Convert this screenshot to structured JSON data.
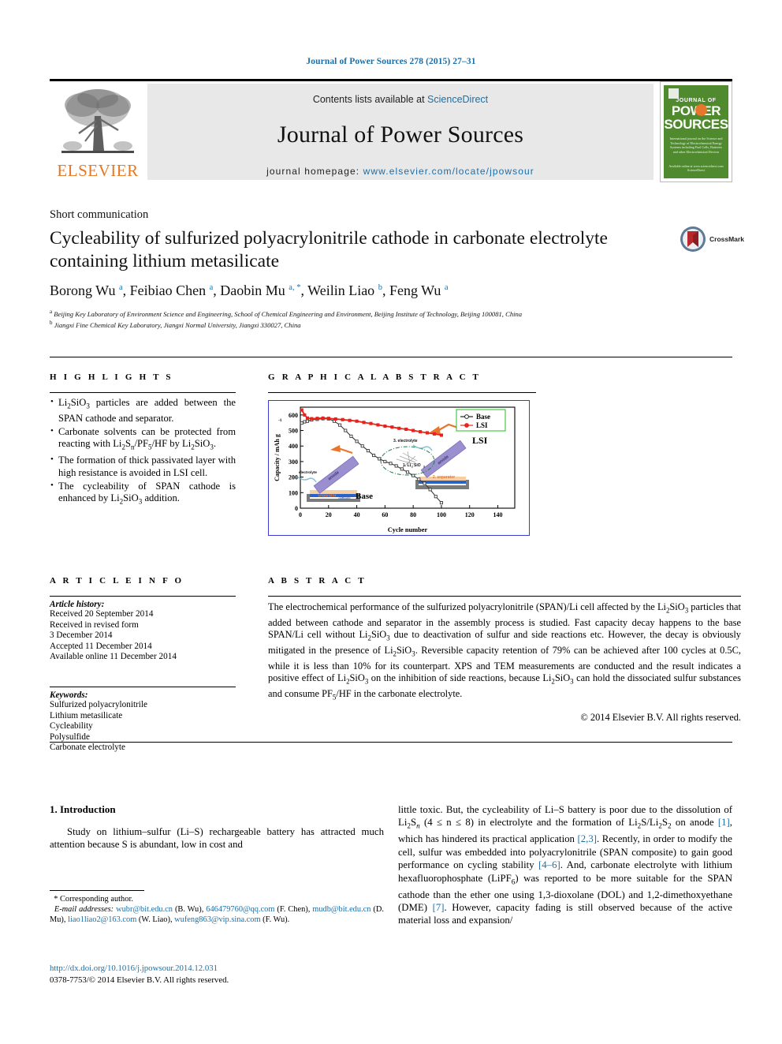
{
  "running_head": "Journal of Power Sources 278 (2015) 27–31",
  "masthead": {
    "contents_prefix": "Contents lists available at ",
    "contents_link": "ScienceDirect",
    "journal_title": "Journal of Power Sources",
    "homepage_label": "journal homepage:",
    "homepage_url": "www.elsevier.com/locate/jpowsour",
    "publisher": "ELSEVIER",
    "cover": {
      "line1": "JOURNAL OF",
      "line2": "POWER",
      "line3": "SOURCES",
      "blurb": "International journal on the Science and Technology of Electrochemical Energy Systems including Fuel Cells, Batteries and other Electrochemical Devices",
      "foot": "Available online at www.sciencedirect.com  ScienceDirect"
    }
  },
  "article_type": "Short communication",
  "title": "Cycleability of sulfurized polyacrylonitrile cathode in carbonate electrolyte containing lithium metasilicate",
  "crossmark_label": "CrossMark",
  "authors": [
    {
      "name": "Borong Wu",
      "sup": "a"
    },
    {
      "name": "Feibiao Chen",
      "sup": "a"
    },
    {
      "name": "Daobin Mu",
      "sup": "a, *"
    },
    {
      "name": "Weilin Liao",
      "sup": "b"
    },
    {
      "name": "Feng Wu",
      "sup": "a"
    }
  ],
  "affiliations": [
    {
      "mark": "a",
      "text": "Beijing Key Laboratory of Environment Science and Engineering, School of Chemical Engineering and Environment, Beijing Institute of Technology, Beijing 100081, China"
    },
    {
      "mark": "b",
      "text": "Jiangxi Fine Chemical Key Laboratory, Jiangxi Normal University, Jiangxi 330027, China"
    }
  ],
  "highlights": {
    "heading": "H I G H L I G H T S",
    "items": [
      "Li2SiO3 particles are added between the SPAN cathode and separator.",
      "Carbonate solvents can be protected from reacting with Li2Sn/PF5/HF by Li2SiO3.",
      "The formation of thick passivated layer with high resistance is avoided in LSI cell.",
      "The cycleability of SPAN cathode is enhanced by Li2SiO3 addition."
    ]
  },
  "graphical_abstract": {
    "heading": "G R A P H I C A L   A B S T R A C T"
  },
  "chart_data": {
    "type": "line",
    "title": "",
    "xlabel": "Cycle number",
    "ylabel": "Capacity / mAh g",
    "ylabel_sup": "-1",
    "xlim": [
      0,
      152
    ],
    "ylim": [
      0,
      650
    ],
    "xticks": [
      0,
      20,
      40,
      60,
      80,
      100,
      120,
      140
    ],
    "yticks": [
      0,
      100,
      200,
      300,
      400,
      500,
      600
    ],
    "grid": false,
    "legend_position": "top-right",
    "series": [
      {
        "name": "Base",
        "color": "#3a3a3a",
        "marker": "open-square",
        "x": [
          1,
          3,
          5,
          8,
          12,
          16,
          20,
          24,
          28,
          32,
          36,
          40,
          44,
          48,
          52,
          56,
          60,
          64,
          68,
          72,
          76,
          80,
          84,
          88,
          92,
          96,
          100
        ],
        "y": [
          548,
          556,
          560,
          568,
          572,
          576,
          575,
          560,
          535,
          500,
          463,
          430,
          400,
          370,
          340,
          318,
          300,
          288,
          272,
          252,
          232,
          210,
          186,
          160,
          120,
          75,
          35
        ]
      },
      {
        "name": "LSI",
        "color": "#e8231a",
        "marker": "filled-square",
        "x": [
          1,
          3,
          5,
          8,
          12,
          16,
          20,
          25,
          30,
          35,
          40,
          45,
          50,
          55,
          60,
          65,
          70,
          75,
          80,
          85,
          90,
          95,
          100
        ],
        "y": [
          632,
          600,
          580,
          576,
          578,
          580,
          578,
          574,
          570,
          565,
          560,
          552,
          545,
          536,
          528,
          522,
          514,
          508,
          500,
          492,
          485,
          478,
          470
        ]
      }
    ],
    "annotations": [
      {
        "text": "LSI",
        "x": 128,
        "y": 430
      },
      {
        "text": "Base",
        "x": 72,
        "y": 48
      },
      {
        "text": "1. Li2SiO3",
        "x": 70,
        "y": 245
      },
      {
        "text": "2. separator",
        "x": 95,
        "y": 268
      },
      {
        "text": "3. electrolyte",
        "x": 78,
        "y": 415
      },
      {
        "text": "electrolyte",
        "x": 9,
        "y": 215
      },
      {
        "text": "anode",
        "x": 30,
        "y": 180
      },
      {
        "text": "separator",
        "x": 24,
        "y": 62
      },
      {
        "text": "cathode",
        "x": 38,
        "y": 42
      }
    ]
  },
  "article_info": {
    "heading": "A R T I C L E   I N F O",
    "history_label": "Article history:",
    "history": [
      "Received 20 September 2014",
      "Received in revised form",
      "3 December 2014",
      "Accepted 11 December 2014",
      "Available online 11 December 2014"
    ],
    "keywords_label": "Keywords:",
    "keywords": [
      "Sulfurized polyacrylonitrile",
      "Lithium metasilicate",
      "Cycleability",
      "Polysulfide",
      "Carbonate electrolyte"
    ]
  },
  "abstract": {
    "heading": "A B S T R A C T",
    "text": "The electrochemical performance of the sulfurized polyacrylonitrile (SPAN)/Li cell affected by the Li2SiO3 particles that added between cathode and separator in the assembly process is studied. Fast capacity decay happens to the base SPAN/Li cell without Li2SiO3 due to deactivation of sulfur and side reactions etc. However, the decay is obviously mitigated in the presence of Li2SiO3. Reversible capacity retention of 79% can be achieved after 100 cycles at 0.5C, while it is less than 10% for its counterpart. XPS and TEM measurements are conducted and the result indicates a positive effect of Li2SiO3 on the inhibition of side reactions, because Li2SiO3 can hold the dissociated sulfur substances and consume PF5/HF in the carbonate electrolyte.",
    "copyright": "© 2014 Elsevier B.V. All rights reserved."
  },
  "introduction": {
    "heading": "1.  Introduction",
    "paragraph_left": "Study on lithium–sulfur (Li–S) rechargeable battery has attracted much attention because S is abundant, low in cost and",
    "paragraph_right": "little toxic. But, the cycleability of Li–S battery is poor due to the dissolution of Li2Sn (4 ≤ n ≤ 8) in electrolyte and the formation of Li2S/Li2S2 on anode [1], which has hindered its practical application [2,3]. Recently, in order to modify the cell, sulfur was embedded into polyacrylonitrile (SPAN composite) to gain good performance on cycling stability [4–6]. And, carbonate electrolyte with lithium hexafluorophosphate (LiPF6) was reported to be more suitable for the SPAN cathode than the ether one using 1,3-dioxolane (DOL) and 1,2-dimethoxyethane (DME) [7]. However, capacity fading is still observed because of the active material loss and expansion/"
  },
  "footnotes": {
    "corresponding": "* Corresponding author.",
    "email_label": "E-mail addresses:",
    "emails": [
      {
        "address": "wubr@bit.edu.cn",
        "person": "(B. Wu)"
      },
      {
        "address": "646479760@qq.com",
        "person": "(F. Chen)"
      },
      {
        "address": "mudb@bit.edu.cn",
        "person": "(D. Mu)"
      },
      {
        "address": "liao1liao2@163.com",
        "person": "(W. Liao)"
      },
      {
        "address": "wufeng863@vip.sina.com",
        "person": "(F. Wu)"
      }
    ]
  },
  "doi": {
    "url": "http://dx.doi.org/10.1016/j.jpowsour.2014.12.031",
    "issn_line": "0378-7753/© 2014 Elsevier B.V. All rights reserved."
  }
}
